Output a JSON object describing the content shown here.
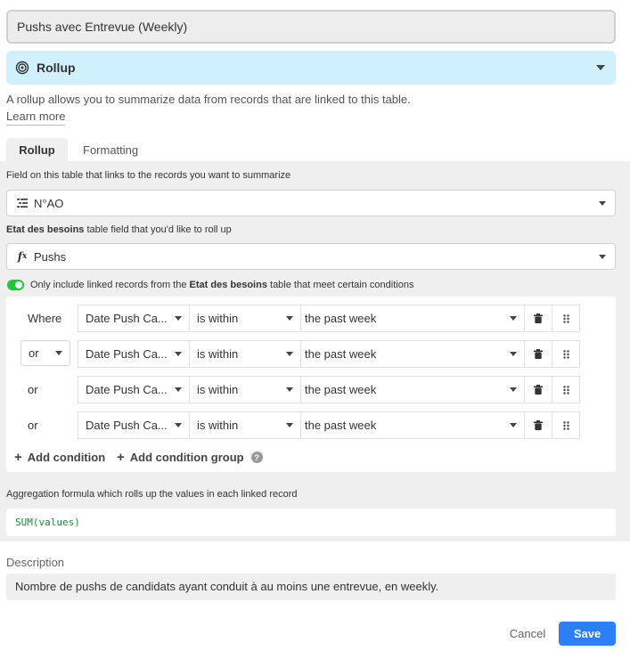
{
  "field_name": "Pushs avec Entrevue (Weekly)",
  "field_type": {
    "label": "Rollup",
    "icon": "rollup-spiral-icon"
  },
  "type_description": "A rollup allows you to summarize data from records that are linked to this table.",
  "learn_more": "Learn more",
  "tabs": [
    {
      "label": "Rollup",
      "active": true
    },
    {
      "label": "Formatting",
      "active": false
    }
  ],
  "link_field": {
    "label": "Field on this table that links to the records you want to summarize",
    "value": "N°AO",
    "icon": "linked-records-icon"
  },
  "rollup_field": {
    "label_table": "Etat des besoins",
    "label_rest": " table field that you'd like to roll up",
    "value": "Pushs",
    "icon": "formula-icon"
  },
  "filter_toggle": {
    "on": true,
    "text_before": "Only include linked records from the ",
    "table_name": "Etat des besoins",
    "text_after": " table that meet certain conditions"
  },
  "conditions": [
    {
      "conjunction": "Where",
      "conjunction_select": false,
      "field": "Date Push Ca...",
      "operator": "is within",
      "value": "the past week"
    },
    {
      "conjunction": "or",
      "conjunction_select": true,
      "field": "Date Push Ca...",
      "operator": "is within",
      "value": "the past week"
    },
    {
      "conjunction": "or",
      "conjunction_select": false,
      "field": "Date Push Ca...",
      "operator": "is within",
      "value": "the past week"
    },
    {
      "conjunction": "or",
      "conjunction_select": false,
      "field": "Date Push Ca...",
      "operator": "is within",
      "value": "the past week"
    }
  ],
  "add_condition": "Add condition",
  "add_condition_group": "Add condition group",
  "aggregation": {
    "label": "Aggregation formula which rolls up the values in each linked record",
    "formula": "SUM(values)"
  },
  "description": {
    "label": "Description",
    "value": "Nombre de pushs de candidats ayant conduit à au moins une entrevue, en weekly."
  },
  "buttons": {
    "cancel": "Cancel",
    "save": "Save"
  },
  "colors": {
    "type_bg": "#d0f0fd",
    "toggle_on": "#20c933",
    "save_bg": "#2d7ff9",
    "formula_text": "#1a8a3a"
  }
}
